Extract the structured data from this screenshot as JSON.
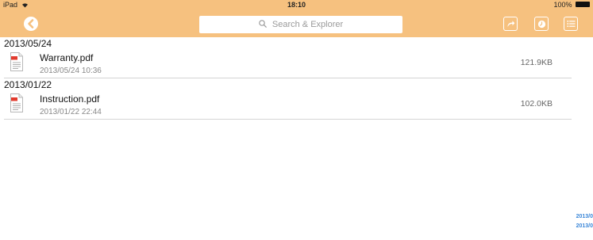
{
  "status_bar": {
    "device": "iPad",
    "time": "18:10",
    "battery": "100%"
  },
  "toolbar": {
    "search_placeholder": "Search & Explorer"
  },
  "groups": [
    {
      "date": "2013/05/24",
      "files": [
        {
          "name": "Warranty.pdf",
          "modified": "2013/05/24 10:36",
          "size": "121.9KB"
        }
      ]
    },
    {
      "date": "2013/01/22",
      "files": [
        {
          "name": "Instruction.pdf",
          "modified": "2013/01/22 22:44",
          "size": "102.0KB"
        }
      ]
    }
  ],
  "index_strip": [
    "2013/0",
    "2013/0"
  ],
  "colors": {
    "bar_background": "#f6c17f",
    "pdf_badge": "#e23b2e",
    "index_link": "#3a86d8"
  }
}
